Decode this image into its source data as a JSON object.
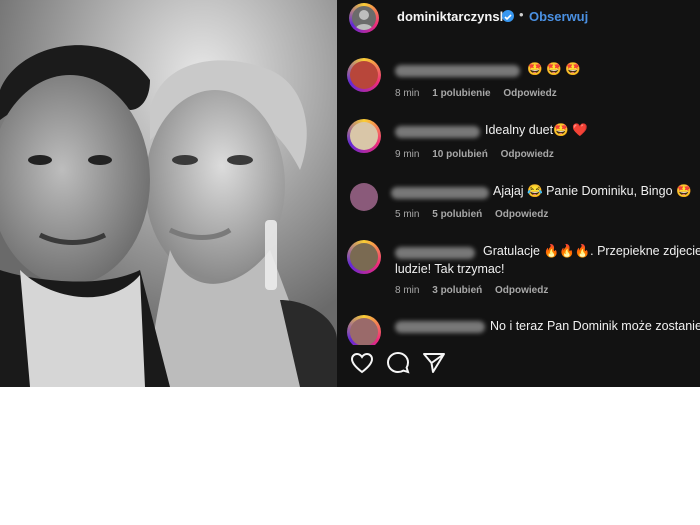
{
  "header": {
    "username": "dominiktarczynski",
    "separator": "•",
    "follow_label": "Obserwuj"
  },
  "comments": [
    {
      "text": "🤩 🤩 🤩",
      "time": "8 min",
      "likes": "1 polubienie",
      "reply": "Odpowiedz"
    },
    {
      "text": "Idealny duet🤩 ❤️",
      "time": "9 min",
      "likes": "10 polubień",
      "reply": "Odpowiedz"
    },
    {
      "text": "Ajajaj 😂 Panie Dominiku, Bingo 🤩",
      "time": "5 min",
      "likes": "5 polubień",
      "reply": "Odpowiedz"
    },
    {
      "text": "Gratulacje 🔥🔥🔥. Przepiekne zdjecie.",
      "text2": "ludzie! Tak trzymac!",
      "time": "8 min",
      "likes": "3 polubień",
      "reply": "Odpowiedz"
    },
    {
      "text": "No i teraz Pan Dominik może zostanie"
    }
  ],
  "icons": {
    "like": "heart-icon",
    "comment": "comment-icon",
    "share": "send-icon",
    "verified": "verified-badge-icon"
  },
  "colors": {
    "panel_bg": "#121212",
    "accent_blue": "#4a90e2",
    "verified_blue": "#3897f0"
  }
}
